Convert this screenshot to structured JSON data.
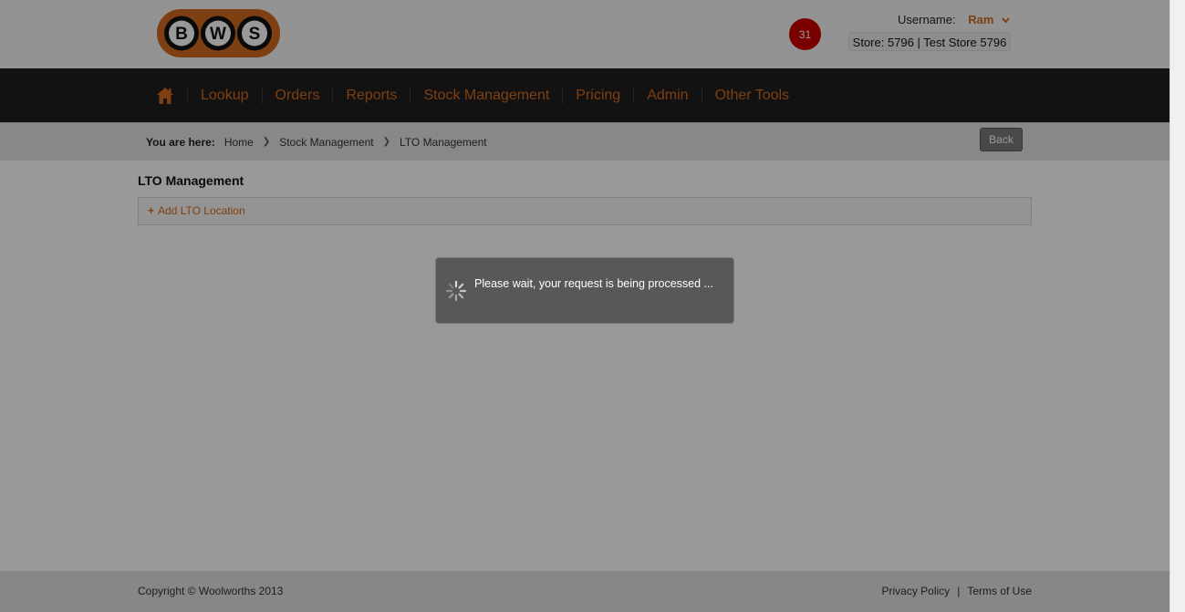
{
  "header": {
    "logo_letters": [
      "B",
      "W",
      "S"
    ],
    "notification_count": "31",
    "username_label": "Username:",
    "username": "Ram",
    "store": "Store: 5796 | Test Store 5796"
  },
  "nav": {
    "items": [
      {
        "label": "Lookup"
      },
      {
        "label": "Orders"
      },
      {
        "label": "Reports"
      },
      {
        "label": "Stock Management"
      },
      {
        "label": "Pricing"
      },
      {
        "label": "Admin"
      },
      {
        "label": "Other Tools"
      }
    ]
  },
  "breadcrumb": {
    "label": "You are here:",
    "items": [
      "Home",
      "Stock Management",
      "LTO Management"
    ],
    "back_label": "Back"
  },
  "main": {
    "title": "LTO Management",
    "add_label": "Add LTO Location"
  },
  "modal": {
    "message": "Please wait, your request is being processed ..."
  },
  "footer": {
    "copyright": "Copyright © Woolworths 2013",
    "privacy": "Privacy Policy",
    "pipe": "|",
    "terms": "Terms of Use"
  },
  "colors": {
    "accent": "#d2691e",
    "nav_bg": "#1f1f1f",
    "badge": "#cc0000",
    "overlay": "rgba(0,0,0,0.40)"
  }
}
